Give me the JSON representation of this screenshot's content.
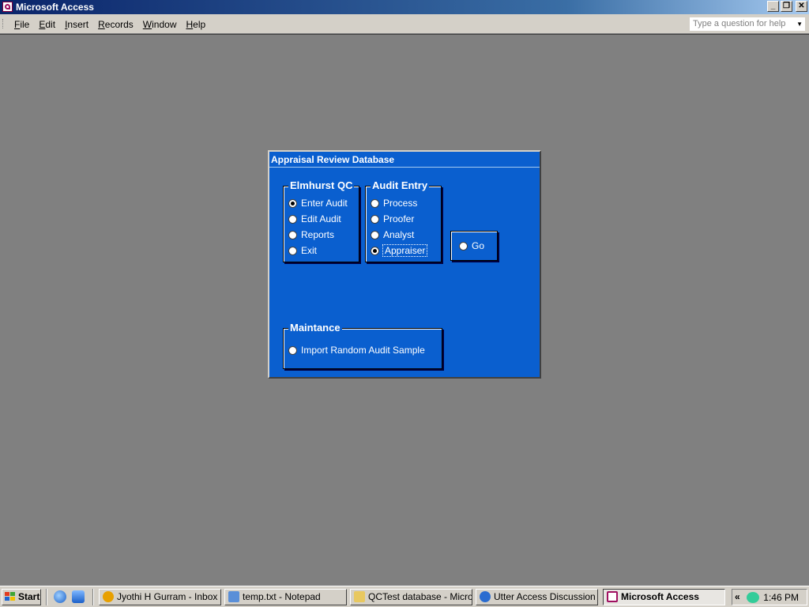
{
  "window": {
    "title": "Microsoft Access",
    "controls": {
      "minimize": "_",
      "restore": "❐",
      "close": "✕"
    }
  },
  "menubar": {
    "items": [
      {
        "key": "F",
        "rest": "ile"
      },
      {
        "key": "E",
        "rest": "dit"
      },
      {
        "key": "I",
        "rest": "nsert"
      },
      {
        "key": "R",
        "rest": "ecords"
      },
      {
        "key": "W",
        "rest": "indow"
      },
      {
        "key": "H",
        "rest": "elp"
      }
    ],
    "help_placeholder": "Type a question for help"
  },
  "form": {
    "title": "Appraisal Review Database",
    "groups": {
      "elmhurst": {
        "legend": "Elmhurst QC",
        "options": [
          "Enter Audit",
          "Edit Audit",
          "Reports",
          "Exit"
        ],
        "selected": "Enter Audit"
      },
      "audit_entry": {
        "legend": "Audit Entry",
        "options": [
          "Process",
          "Proofer",
          "Analyst",
          "Appraiser"
        ],
        "selected": "Appraiser"
      },
      "go": {
        "label": "Go"
      },
      "maintance": {
        "legend": "Maintance",
        "options": [
          "Import Random Audit Sample"
        ]
      }
    }
  },
  "taskbar": {
    "start_label": "Start",
    "tasks": [
      {
        "label": "Jyothi H Gurram - Inbox - ...",
        "icon": "lotus-notes-icon",
        "color": "#e8a000"
      },
      {
        "label": "temp.txt - Notepad",
        "icon": "notepad-icon",
        "color": "#5a8fd8"
      },
      {
        "label": "QCTest database - Micro...",
        "icon": "folder-icon",
        "color": "#e8c860"
      },
      {
        "label": "Utter Access Discussion ...",
        "icon": "ie-icon",
        "color": "#2a6cd0"
      },
      {
        "label": "Microsoft Access",
        "icon": "access-icon",
        "color": "#a01060"
      }
    ],
    "clock": "1:46 PM",
    "tray_chevron": "«"
  }
}
